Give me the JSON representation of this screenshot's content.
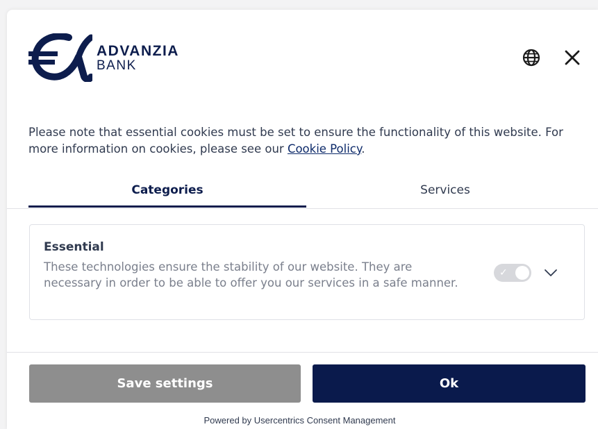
{
  "brand": {
    "name": "ADVANZIA",
    "sub": "BANK",
    "color": "#0d1d4d"
  },
  "header": {
    "language_icon": "globe-icon",
    "close_icon": "close-icon"
  },
  "notice": {
    "text_before": "Please note that essential cookies must be set to ensure the functionality of this website. For more information on cookies, please see our ",
    "link_label": "Cookie Policy",
    "text_after": "."
  },
  "tabs": [
    {
      "label": "Categories",
      "active": true
    },
    {
      "label": "Services",
      "active": false
    }
  ],
  "categories": [
    {
      "title": "Essential",
      "description": "These technologies ensure the stability of our website. They are necessary in order to be able to offer you our services in a safe manner.",
      "toggle_on": true,
      "toggle_disabled": true
    }
  ],
  "buttons": {
    "save_label": "Save settings",
    "ok_label": "Ok"
  },
  "footer": {
    "powered_by": "Powered by Usercentrics Consent Management"
  },
  "colors": {
    "primary": "#0a1a4c",
    "secondary_button": "#8e8e8e",
    "text": "#303a4f"
  }
}
